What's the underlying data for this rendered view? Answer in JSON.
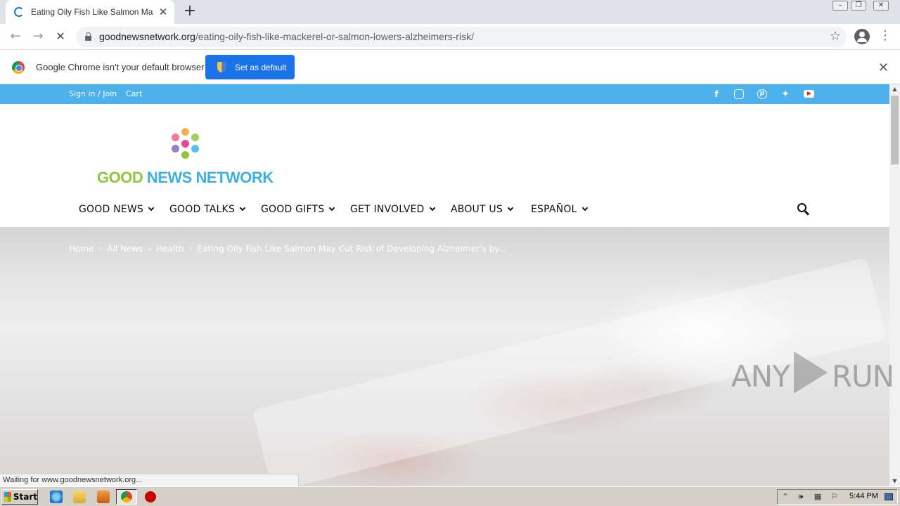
{
  "browser": {
    "tab_title": "Eating Oily Fish Like Salmon May Cut",
    "url_domain": "goodnewsnetwork.org",
    "url_path": "/eating-oily-fish-like-mackerel-or-salmon-lowers-alzheimers-risk/",
    "new_tab": "+",
    "close": "✕",
    "back": "←",
    "forward": "→",
    "reload": "✕",
    "star": "☆",
    "menu": "⋮"
  },
  "infobar": {
    "text": "Google Chrome isn't your default browser",
    "button_label": "Set as default",
    "close": "✕"
  },
  "site": {
    "topbar_links": [
      "Sign in / Join",
      "Cart"
    ],
    "social_icons": [
      "facebook-icon",
      "instagram-icon",
      "pinterest-icon",
      "twitter-icon",
      "youtube-icon"
    ],
    "logo_good": "GOOD",
    "logo_rest": " NEWS NETWORK",
    "nav": [
      "GOOD NEWS",
      "GOOD TALKS",
      "GOOD GIFTS",
      "GET INVOLVED",
      "ABOUT US",
      "ESPAÑOL"
    ],
    "breadcrumb": [
      "Home",
      "All News",
      "Health",
      "Eating Oily Fish Like Salmon May Cut Risk of Developing Alzheimer's by..."
    ],
    "breadcrumb_sep": "›",
    "colors": {
      "topbar": "#4db2ec",
      "logo_green": "#8dc63f",
      "logo_blue": "#3fb0e0"
    },
    "logo_dots": [
      "#f4b24d",
      "#f47b8f",
      "#a6ce5b",
      "#e8498a",
      "#9b7fc7",
      "#57c0e8",
      "#8dc63f"
    ]
  },
  "status": "Waiting for www.goodnewsnetwork.org...",
  "watermark": {
    "left": "ANY",
    "right": "RUN"
  },
  "taskbar": {
    "start": "Start",
    "clock": "5:44 PM"
  }
}
